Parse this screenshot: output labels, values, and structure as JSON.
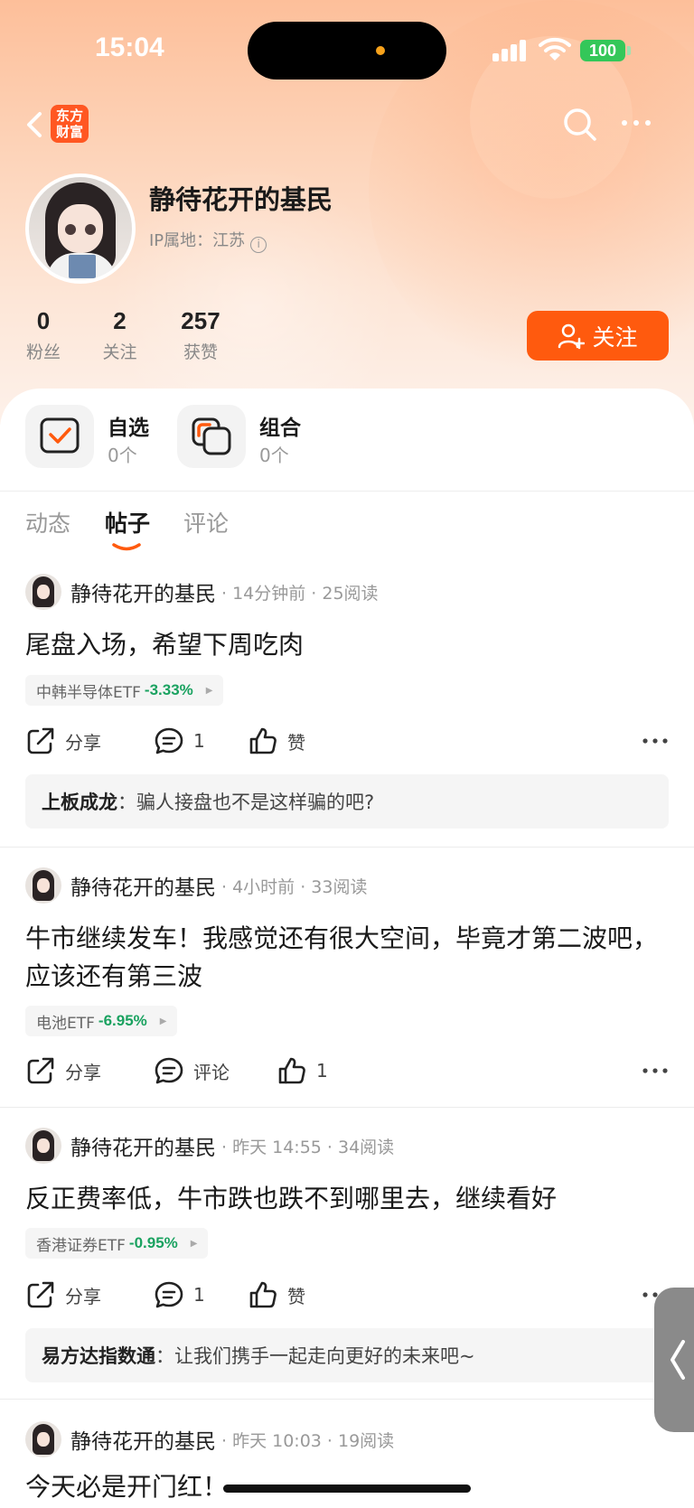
{
  "status_bar": {
    "time": "15:04",
    "battery": "100"
  },
  "nav": {
    "logo_line1": "东方",
    "logo_line2": "财富"
  },
  "profile": {
    "name": "静待花开的基民",
    "ip_label": "IP属地：江苏",
    "stats": [
      {
        "value": "0",
        "label": "粉丝"
      },
      {
        "value": "2",
        "label": "关注"
      },
      {
        "value": "257",
        "label": "获赞"
      }
    ],
    "follow_label": "关注"
  },
  "quick": {
    "watchlist": {
      "title": "自选",
      "count": "0个"
    },
    "portfolio": {
      "title": "组合",
      "count": "0个"
    }
  },
  "tabs": [
    {
      "label": "动态",
      "active": false
    },
    {
      "label": "帖子",
      "active": true
    },
    {
      "label": "评论",
      "active": false
    }
  ],
  "posts": [
    {
      "author": "静待花开的基民",
      "meta": "· 14分钟前 · 25阅读",
      "text": "尾盘入场，希望下周吃肉",
      "stock": "中韩半导体ETF",
      "change": "-3.33%",
      "share": "分享",
      "comments": "1",
      "likes": "赞",
      "reply_user": "上板成龙",
      "reply_text": "：骗人接盘也不是这样骗的吧?"
    },
    {
      "author": "静待花开的基民",
      "meta": "· 4小时前 · 33阅读",
      "text": "牛市继续发车！我感觉还有很大空间，毕竟才第二波吧，应该还有第三波",
      "stock": "电池ETF",
      "change": "-6.95%",
      "share": "分享",
      "comments": "评论",
      "likes": "1"
    },
    {
      "author": "静待花开的基民",
      "meta": "· 昨天 14:55 · 34阅读",
      "text": "反正费率低，牛市跌也跌不到哪里去，继续看好",
      "stock": "香港证券ETF",
      "change": "-0.95%",
      "share": "分享",
      "comments": "1",
      "likes": "赞",
      "reply_user": "易方达指数通",
      "reply_text": "：让我们携手一起走向更好的未来吧~"
    },
    {
      "author": "静待花开的基民",
      "meta": "· 昨天 10:03 · 19阅读",
      "text": "今天必是开门红！"
    }
  ],
  "colors": {
    "accent": "#ff5a0e",
    "down": "#1aa260",
    "logo": "#ff5722"
  }
}
